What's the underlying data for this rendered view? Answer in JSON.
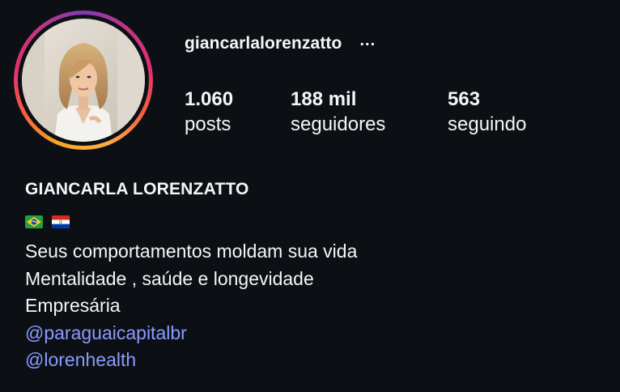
{
  "profile": {
    "username": "giancarlalorenzatto",
    "more_icon": "...",
    "avatar_icon": "profile-photo",
    "stats": {
      "posts": {
        "value": "1.060",
        "label": "posts"
      },
      "followers": {
        "value": "188 mil",
        "label": "seguidores"
      },
      "following": {
        "value": "563",
        "label": "seguindo"
      }
    },
    "full_name": "GIANCARLA LORENZATTO",
    "flags": [
      "flag-brazil-icon",
      "flag-paraguay-icon"
    ],
    "bio": {
      "line1": "Seus comportamentos moldam sua vida",
      "line2": "Mentalidade , saúde e longevidade",
      "line3": "Empresária",
      "link1": "@paraguaicapitalbr",
      "link2": "@lorenhealth"
    }
  },
  "colors": {
    "background": "#0c1014",
    "text": "#f5f5f5",
    "link": "#8b9cff",
    "ring_gradient": [
      "#fcaf45",
      "#f56040",
      "#e1306c",
      "#c13584",
      "#833ab4"
    ]
  }
}
